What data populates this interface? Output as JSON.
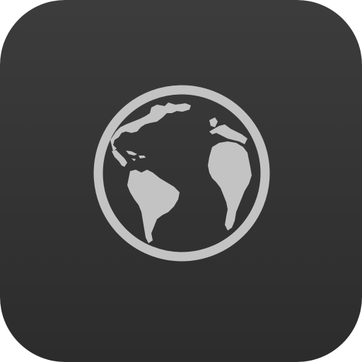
{
  "icon": {
    "name": "globe-icon",
    "background_top": "#3c3c3c",
    "background_bottom": "#2c2c2c",
    "glyph_color": "#c3c3c3"
  }
}
